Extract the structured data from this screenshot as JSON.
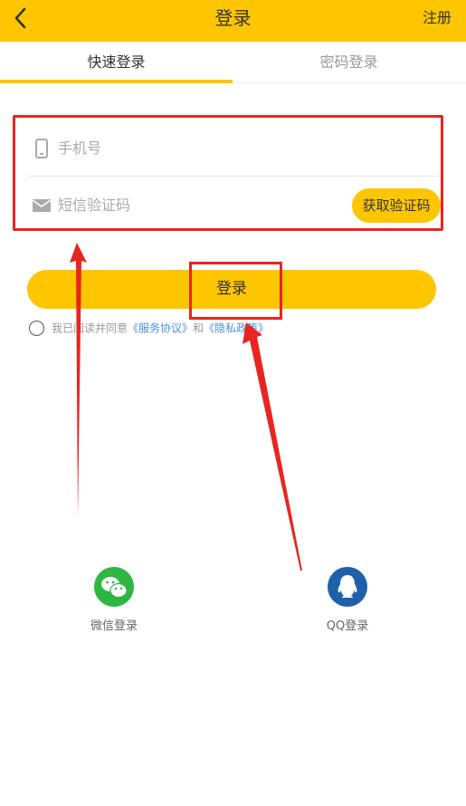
{
  "header": {
    "title": "登录",
    "register_label": "注册"
  },
  "tabs": [
    {
      "label": "快速登录",
      "active": true
    },
    {
      "label": "密码登录",
      "active": false
    }
  ],
  "form": {
    "phone_placeholder": "手机号",
    "code_placeholder": "短信验证码",
    "get_code_label": "获取验证码"
  },
  "login_label": "登录",
  "agreement": {
    "prefix": "我已阅读并同意",
    "service_link": "《服务协议》",
    "and": "和",
    "privacy_link": "《隐私政策》"
  },
  "social": [
    {
      "label": "微信登录",
      "icon": "wechat-icon",
      "color": "#2DB742"
    },
    {
      "label": "QQ登录",
      "icon": "qq-icon",
      "color": "#1E61A8"
    }
  ],
  "colors": {
    "accent": "#FDC600",
    "annotation": "#E9251F",
    "link": "#4A90E2"
  }
}
